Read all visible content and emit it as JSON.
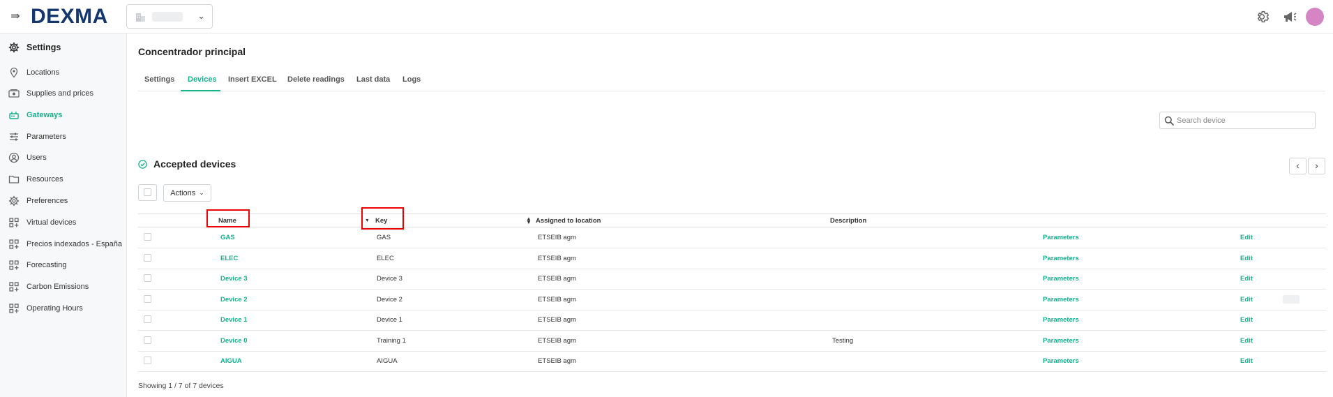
{
  "header": {
    "logo_text": "DEXMA",
    "site_selector_value": "",
    "avatar_color": "#d685c4"
  },
  "sidebar": {
    "heading": "Settings",
    "items": [
      {
        "label": "Locations",
        "icon": "location-pin-icon"
      },
      {
        "label": "Supplies and prices",
        "icon": "money-icon"
      },
      {
        "label": "Gateways",
        "icon": "gateway-icon",
        "active": true
      },
      {
        "label": "Parameters",
        "icon": "sliders-icon"
      },
      {
        "label": "Users",
        "icon": "user-icon"
      },
      {
        "label": "Resources",
        "icon": "folder-icon"
      },
      {
        "label": "Preferences",
        "icon": "gear-icon"
      },
      {
        "label": "Virtual devices",
        "icon": "apps-icon"
      },
      {
        "label": "Precios indexados - España",
        "icon": "apps-icon"
      },
      {
        "label": "Forecasting",
        "icon": "apps-icon"
      },
      {
        "label": "Carbon Emissions",
        "icon": "apps-icon"
      },
      {
        "label": "Operating Hours",
        "icon": "apps-icon"
      }
    ]
  },
  "main": {
    "title": "Concentrador principal",
    "tabs": [
      {
        "label": "Settings"
      },
      {
        "label": "Devices",
        "active": true
      },
      {
        "label": "Insert EXCEL"
      },
      {
        "label": "Delete readings"
      },
      {
        "label": "Last data"
      },
      {
        "label": "Logs"
      }
    ],
    "search": {
      "placeholder": "Search device",
      "value": ""
    },
    "section_title": "Accepted devices",
    "actions_label": "Actions",
    "table": {
      "headers": {
        "name": "Name",
        "key": "Key",
        "location": "Assigned to location",
        "description": "Description"
      },
      "rows": [
        {
          "name": "GAS",
          "key": "GAS",
          "location": "ETSEIB agm",
          "description": "",
          "params": "Parameters",
          "edit": "Edit"
        },
        {
          "name": "ELEC",
          "key": "ELEC",
          "location": "ETSEIB agm",
          "description": "",
          "params": "Parameters",
          "edit": "Edit"
        },
        {
          "name": "Device 3",
          "key": "Device 3",
          "location": "ETSEIB agm",
          "description": "",
          "params": "Parameters",
          "edit": "Edit"
        },
        {
          "name": "Device 2",
          "key": "Device 2",
          "location": "ETSEIB agm",
          "description": "",
          "params": "Parameters",
          "edit": "Edit"
        },
        {
          "name": "Device 1",
          "key": "Device 1",
          "location": "ETSEIB agm",
          "description": "",
          "params": "Parameters",
          "edit": "Edit"
        },
        {
          "name": "Device 0",
          "key": "Training 1",
          "location": "ETSEIB agm",
          "description": "Testing",
          "params": "Parameters",
          "edit": "Edit"
        },
        {
          "name": "AIGUA",
          "key": "AIGUA",
          "location": "ETSEIB agm",
          "description": "",
          "params": "Parameters",
          "edit": "Edit"
        }
      ]
    },
    "footer": "Showing 1 / 7 of 7 devices"
  },
  "colors": {
    "accent": "#12b38d",
    "brand": "#15376e",
    "highlight": "#e00000"
  }
}
